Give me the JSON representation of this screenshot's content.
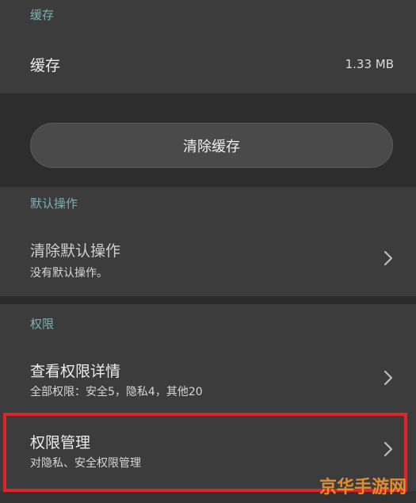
{
  "cache_section": {
    "header": "缓存",
    "row_title": "缓存",
    "row_value": "1.33 MB",
    "clear_button": "清除缓存"
  },
  "defaults_section": {
    "header": "默认操作",
    "row_title": "清除默认操作",
    "row_subtitle": "没有默认操作。"
  },
  "permissions_section": {
    "header": "权限",
    "details_title": "查看权限详情",
    "details_subtitle": "全部权限：安全5，隐私4，其他20",
    "manage_title": "权限管理",
    "manage_subtitle": "对隐私、安全权限管理"
  },
  "watermark": "京华手游网",
  "colors": {
    "background": "#3a3a3a",
    "section_label": "#7fb0b2",
    "highlight_border": "#e0242a"
  },
  "icons": [
    "chevron-right-icon"
  ]
}
